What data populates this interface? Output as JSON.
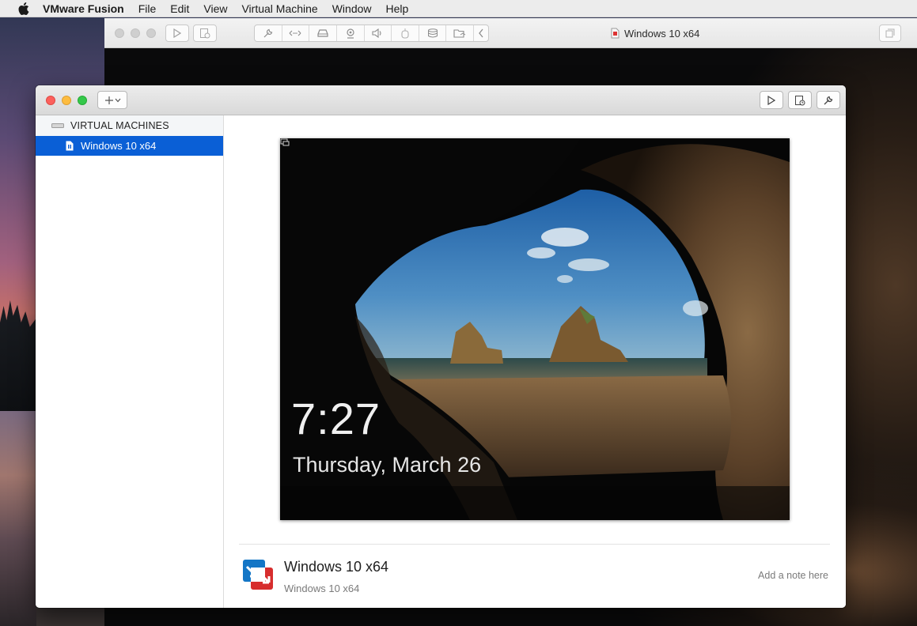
{
  "menubar": {
    "app_name": "VMware Fusion",
    "items": [
      "File",
      "Edit",
      "View",
      "Virtual Machine",
      "Window",
      "Help"
    ]
  },
  "vm_window": {
    "title": "Windows 10 x64",
    "toolbar_icons": [
      "play-icon",
      "snapshot-icon",
      "settings-wrench-icon",
      "network-icon",
      "hard-disk-icon",
      "camera-icon",
      "sound-icon",
      "usb-icon",
      "drive-icon",
      "shared-folders-icon",
      "chevron-left-icon",
      "fullscreen-icon"
    ]
  },
  "library": {
    "sidebar": {
      "header": "VIRTUAL MACHINES",
      "items": [
        {
          "label": "Windows 10 x64",
          "selected": true
        }
      ]
    },
    "preview": {
      "time": "7:27",
      "date": "Thursday, March 26"
    },
    "details": {
      "name": "Windows 10 x64",
      "os": "Windows 10 x64",
      "note_placeholder": "Add a note here"
    }
  },
  "colors": {
    "selection": "#0a5fd6",
    "close": "#fc605c",
    "minimize": "#fdbc40",
    "maximize": "#34c84a"
  }
}
